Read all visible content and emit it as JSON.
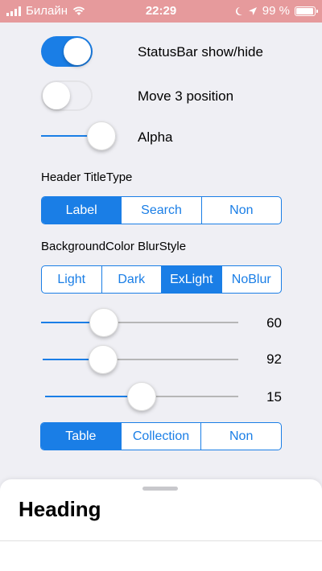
{
  "status_bar": {
    "carrier": "Билайн",
    "time": "22:29",
    "battery": "99 %"
  },
  "controls": {
    "statusbar_toggle": {
      "label": "StatusBar show/hide",
      "on": true
    },
    "move_toggle": {
      "label": "Move 3 position",
      "on": false
    },
    "alpha": {
      "label": "Alpha",
      "fraction": 1.0
    }
  },
  "header_title_type": {
    "title": "Header TitleType",
    "options": [
      "Label",
      "Search",
      "Non"
    ],
    "selected": 0
  },
  "blur_style": {
    "title": "BackgroundColor BlurStyle",
    "options": [
      "Light",
      "Dark",
      "ExLight",
      "NoBlur"
    ],
    "selected": 2
  },
  "sliders": [
    {
      "value": "60",
      "fraction": 0.32
    },
    {
      "value": "92",
      "fraction": 0.31
    },
    {
      "value": "15",
      "fraction": 0.5
    }
  ],
  "content_type": {
    "options": [
      "Table",
      "Collection",
      "Non"
    ],
    "selected": 0
  },
  "sheet": {
    "heading": "Heading"
  },
  "colors": {
    "accent": "#1a7ee6",
    "status_bar_bg": "#e69a9c",
    "background": "#efeff4"
  }
}
